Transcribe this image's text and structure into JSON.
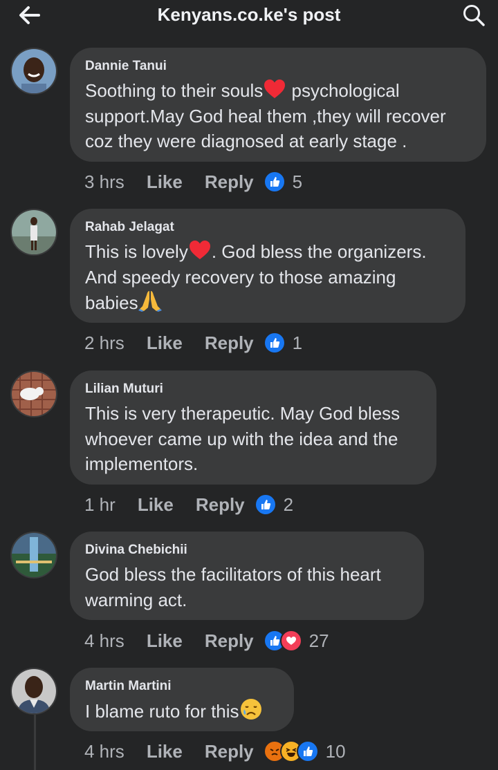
{
  "header": {
    "title": "Kenyans.co.ke's post"
  },
  "comments": [
    {
      "author": "Dannie Tanui",
      "text_a": "Soothing to their souls",
      "text_b": " psychological\nsupport.May God heal them ,they will recover\ncoz they were diagnosed at early stage .",
      "time": "3 hrs",
      "like": "Like",
      "reply": "Reply",
      "count": "5"
    },
    {
      "author": "Rahab Jelagat",
      "text_a": "This is lovely",
      "text_b": ". God bless the organizers.\nAnd speedy recovery to those amazing\nbabies",
      "time": "2 hrs",
      "like": "Like",
      "reply": "Reply",
      "count": "1"
    },
    {
      "author": "Lilian Muturi",
      "text": "This is very therapeutic. May God bless\nwhoever came up with the idea and the\nimplementors.",
      "time": "1 hr",
      "like": "Like",
      "reply": "Reply",
      "count": "2"
    },
    {
      "author": "Divina Chebichii",
      "text": "God bless the facilitators of this heart\nwarming act.",
      "time": "4 hrs",
      "like": "Like",
      "reply": "Reply",
      "count": "27"
    },
    {
      "author": "Martin Martini",
      "text": "I blame ruto for this",
      "time": "4 hrs",
      "like": "Like",
      "reply": "Reply",
      "count": "10"
    }
  ],
  "colors": {
    "background": "#242526",
    "bubble": "#3a3b3c",
    "like_blue": "#1877f2",
    "love_red": "#f33e58",
    "secondary_text": "#b0b3b8"
  }
}
